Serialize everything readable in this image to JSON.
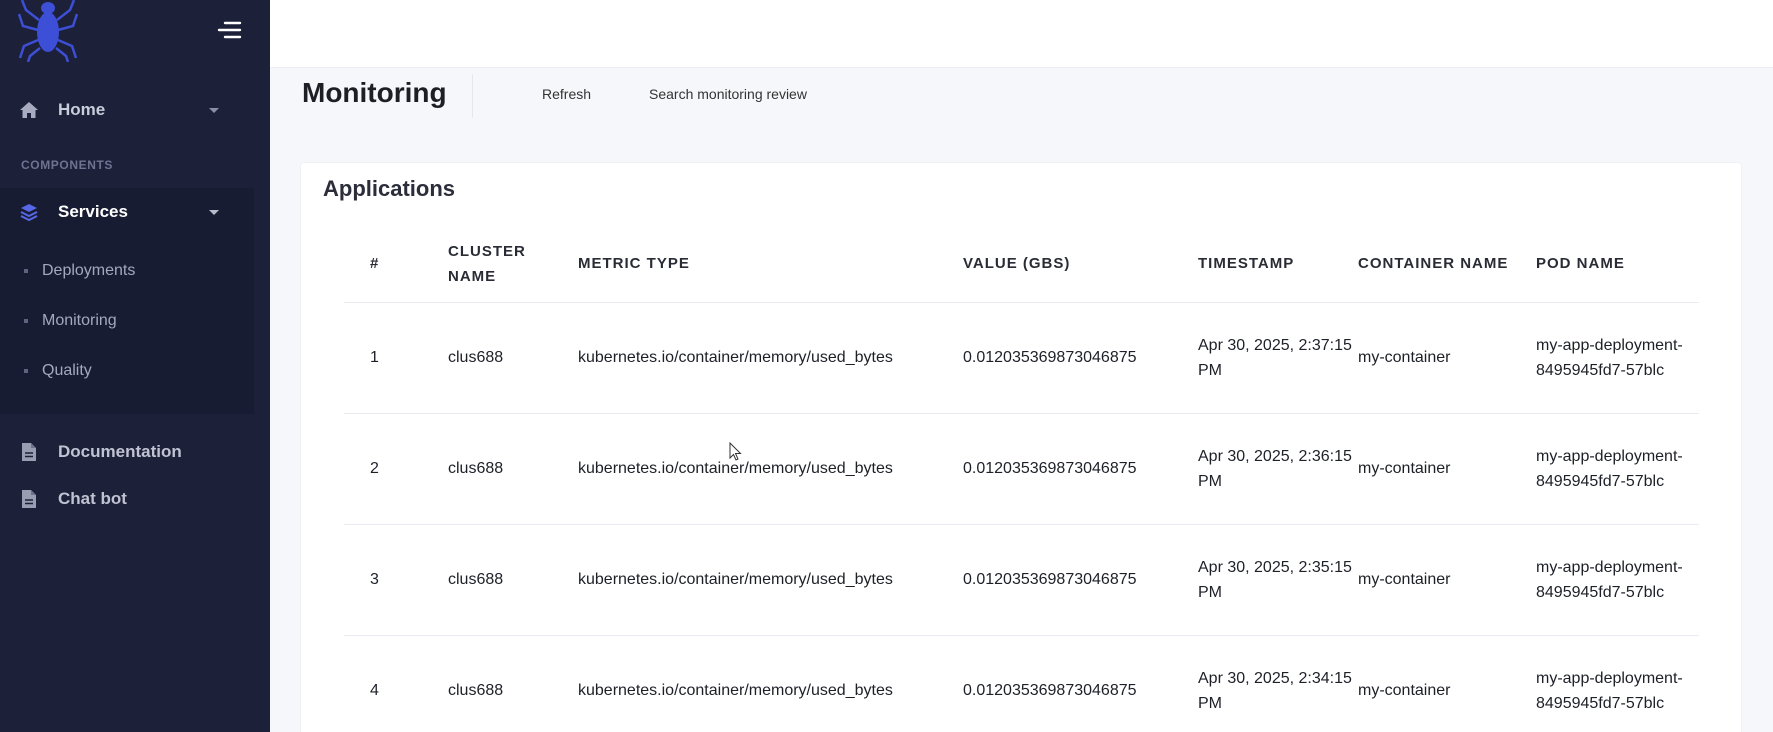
{
  "sidebar": {
    "home_label": "Home",
    "section_title": "COMPONENTS",
    "services_label": "Services",
    "sub_items": [
      {
        "label": "Deployments"
      },
      {
        "label": "Monitoring"
      },
      {
        "label": "Quality"
      }
    ],
    "documentation_label": "Documentation",
    "chatbot_label": "Chat bot"
  },
  "header": {
    "title": "Monitoring",
    "refresh_label": "Refresh",
    "search_label": "Search monitoring review"
  },
  "card": {
    "title": "Applications"
  },
  "table": {
    "columns": [
      "#",
      "CLUSTER NAME",
      "METRIC TYPE",
      "VALUE (GBS)",
      "TIMESTAMP",
      "CONTAINER NAME",
      "POD NAME"
    ],
    "rows": [
      {
        "num": "1",
        "cluster": "clus688",
        "metric": "kubernetes.io/container/memory/used_bytes",
        "value": "0.012035369873046875",
        "timestamp": "Apr 30, 2025, 2:37:15 PM",
        "container": "my-container",
        "pod": "my-app-deployment-8495945fd7-57blc"
      },
      {
        "num": "2",
        "cluster": "clus688",
        "metric": "kubernetes.io/container/memory/used_bytes",
        "value": "0.012035369873046875",
        "timestamp": "Apr 30, 2025, 2:36:15 PM",
        "container": "my-container",
        "pod": "my-app-deployment-8495945fd7-57blc"
      },
      {
        "num": "3",
        "cluster": "clus688",
        "metric": "kubernetes.io/container/memory/used_bytes",
        "value": "0.012035369873046875",
        "timestamp": "Apr 30, 2025, 2:35:15 PM",
        "container": "my-container",
        "pod": "my-app-deployment-8495945fd7-57blc"
      },
      {
        "num": "4",
        "cluster": "clus688",
        "metric": "kubernetes.io/container/memory/used_bytes",
        "value": "0.012035369873046875",
        "timestamp": "Apr 30, 2025, 2:34:15 PM",
        "container": "my-container",
        "pod": "my-app-deployment-8495945fd7-57blc"
      }
    ]
  },
  "colors": {
    "sidebar_bg": "#1c2039",
    "accent": "#3d4fd6"
  },
  "icons": [
    "spider-logo",
    "menu-toggle-icon",
    "home-icon",
    "layers-icon",
    "document-icon"
  ]
}
